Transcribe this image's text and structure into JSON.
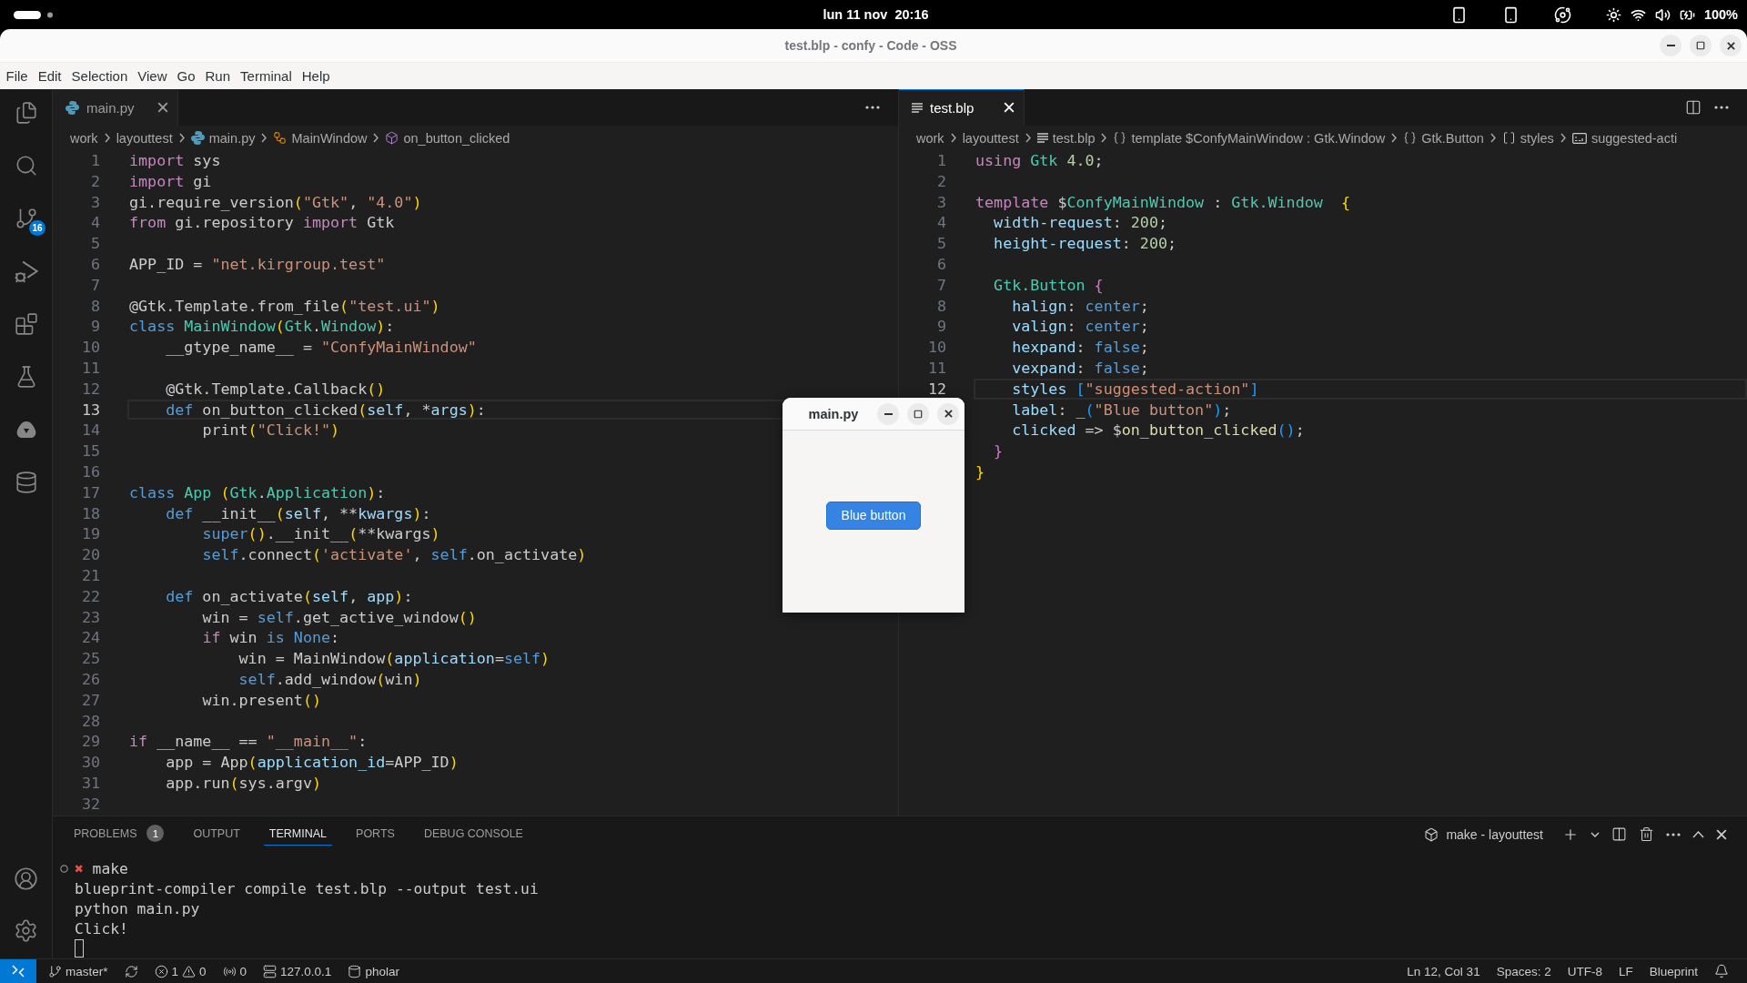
{
  "top_bar": {
    "clock": "lun 11 nov  20:16",
    "battery": "100%"
  },
  "window": {
    "title": "test.blp - confy - Code - OSS"
  },
  "menu": [
    "File",
    "Edit",
    "Selection",
    "View",
    "Go",
    "Run",
    "Terminal",
    "Help"
  ],
  "activity_bar": {
    "source_control_badge": "16"
  },
  "editor_groups": [
    {
      "focused": false,
      "tabs": [
        {
          "label": "main.py",
          "kind": "python",
          "selected": true
        }
      ],
      "breadcrumbs": [
        {
          "label": "work",
          "kind": "folder"
        },
        {
          "label": "layouttest",
          "kind": "folder"
        },
        {
          "label": "main.py",
          "kind": "python"
        },
        {
          "label": "MainWindow",
          "kind": "class"
        },
        {
          "label": "on_button_clicked",
          "kind": "method"
        }
      ],
      "lines": [
        {
          "number": "1",
          "current": false,
          "tokens": [
            {
              "kind": "keyword",
              "text": "import"
            },
            {
              "kind": "plain",
              "text": " sys"
            }
          ]
        },
        {
          "number": "2",
          "current": false,
          "tokens": [
            {
              "kind": "keyword",
              "text": "import"
            },
            {
              "kind": "plain",
              "text": " gi"
            }
          ]
        },
        {
          "number": "3",
          "current": false,
          "tokens": [
            {
              "kind": "plain",
              "text": "gi.require_version"
            },
            {
              "kind": "bracket1",
              "text": "("
            },
            {
              "kind": "string",
              "text": "\"Gtk\""
            },
            {
              "kind": "plain",
              "text": ", "
            },
            {
              "kind": "string",
              "text": "\"4.0\""
            },
            {
              "kind": "bracket1",
              "text": ")"
            }
          ]
        },
        {
          "number": "4",
          "current": false,
          "tokens": [
            {
              "kind": "keyword",
              "text": "from"
            },
            {
              "kind": "plain",
              "text": " gi.repository "
            },
            {
              "kind": "keyword",
              "text": "import"
            },
            {
              "kind": "plain",
              "text": " Gtk"
            }
          ]
        },
        {
          "number": "5",
          "current": false
        },
        {
          "number": "6",
          "current": false,
          "tokens": [
            {
              "kind": "plain",
              "text": "APP_ID = "
            },
            {
              "kind": "string",
              "text": "\"net.kirgroup.test\""
            }
          ]
        },
        {
          "number": "7",
          "current": false
        },
        {
          "number": "8",
          "current": false,
          "tokens": [
            {
              "kind": "plain",
              "text": "@Gtk.Template.from_file"
            },
            {
              "kind": "bracket1",
              "text": "("
            },
            {
              "kind": "string",
              "text": "\"test.ui\""
            },
            {
              "kind": "bracket1",
              "text": ")"
            }
          ]
        },
        {
          "number": "9",
          "current": false,
          "tokens": [
            {
              "kind": "storage",
              "text": "class "
            },
            {
              "kind": "type",
              "text": "MainWindow"
            },
            {
              "kind": "bracket1",
              "text": "("
            },
            {
              "kind": "type",
              "text": "Gtk"
            },
            {
              "kind": "plain",
              "text": "."
            },
            {
              "kind": "type",
              "text": "Window"
            },
            {
              "kind": "bracket1",
              "text": ")"
            },
            {
              "kind": "plain",
              "text": ":"
            }
          ]
        },
        {
          "number": "10",
          "current": false,
          "tokens": [
            {
              "kind": "plain",
              "text": "    __gtype_name__ = "
            },
            {
              "kind": "string",
              "text": "\"ConfyMainWindow\""
            }
          ]
        },
        {
          "number": "11",
          "current": false
        },
        {
          "number": "12",
          "current": false,
          "tokens": [
            {
              "kind": "plain",
              "text": "    @Gtk.Template.Callback"
            },
            {
              "kind": "bracket1",
              "text": "()"
            }
          ]
        },
        {
          "number": "13",
          "current": true,
          "tokens": [
            {
              "kind": "storage",
              "text": "    def"
            },
            {
              "kind": "plain",
              "text": " on_button_clicked"
            },
            {
              "kind": "bracket1",
              "text": "("
            },
            {
              "kind": "param",
              "text": "self"
            },
            {
              "kind": "plain",
              "text": ", *"
            },
            {
              "kind": "param",
              "text": "args"
            },
            {
              "kind": "bracket1",
              "text": ")"
            },
            {
              "kind": "plain",
              "text": ":"
            }
          ]
        },
        {
          "number": "14",
          "current": false,
          "tokens": [
            {
              "kind": "plain",
              "text": "        print"
            },
            {
              "kind": "bracket1",
              "text": "("
            },
            {
              "kind": "string",
              "text": "\"Click!\""
            },
            {
              "kind": "bracket1",
              "text": ")"
            }
          ]
        },
        {
          "number": "15",
          "current": false
        },
        {
          "number": "16",
          "current": false
        },
        {
          "number": "17",
          "current": false,
          "tokens": [
            {
              "kind": "storage",
              "text": "class "
            },
            {
              "kind": "type",
              "text": "App "
            },
            {
              "kind": "bracket1",
              "text": "("
            },
            {
              "kind": "type",
              "text": "Gtk"
            },
            {
              "kind": "plain",
              "text": "."
            },
            {
              "kind": "type",
              "text": "Application"
            },
            {
              "kind": "bracket1",
              "text": ")"
            },
            {
              "kind": "plain",
              "text": ":"
            }
          ]
        },
        {
          "number": "18",
          "current": false,
          "tokens": [
            {
              "kind": "storage",
              "text": "    def"
            },
            {
              "kind": "plain",
              "text": " __init__"
            },
            {
              "kind": "bracket1",
              "text": "("
            },
            {
              "kind": "param",
              "text": "self"
            },
            {
              "kind": "plain",
              "text": ", **"
            },
            {
              "kind": "param",
              "text": "kwargs"
            },
            {
              "kind": "bracket1",
              "text": ")"
            },
            {
              "kind": "plain",
              "text": ":"
            }
          ]
        },
        {
          "number": "19",
          "current": false,
          "tokens": [
            {
              "kind": "storage",
              "text": "        super"
            },
            {
              "kind": "bracket1",
              "text": "()"
            },
            {
              "kind": "plain",
              "text": ".__init__"
            },
            {
              "kind": "bracket1",
              "text": "("
            },
            {
              "kind": "plain",
              "text": "**kwargs"
            },
            {
              "kind": "bracket1",
              "text": ")"
            }
          ]
        },
        {
          "number": "20",
          "current": false,
          "tokens": [
            {
              "kind": "storage",
              "text": "        self"
            },
            {
              "kind": "plain",
              "text": ".connect"
            },
            {
              "kind": "bracket1",
              "text": "("
            },
            {
              "kind": "string",
              "text": "'activate'"
            },
            {
              "kind": "plain",
              "text": ", "
            },
            {
              "kind": "storage",
              "text": "self"
            },
            {
              "kind": "plain",
              "text": ".on_activate"
            },
            {
              "kind": "bracket1",
              "text": ")"
            }
          ]
        },
        {
          "number": "21",
          "current": false
        },
        {
          "number": "22",
          "current": false,
          "tokens": [
            {
              "kind": "storage",
              "text": "    def"
            },
            {
              "kind": "plain",
              "text": " on_activate"
            },
            {
              "kind": "bracket1",
              "text": "("
            },
            {
              "kind": "param",
              "text": "self"
            },
            {
              "kind": "plain",
              "text": ", "
            },
            {
              "kind": "param",
              "text": "app"
            },
            {
              "kind": "bracket1",
              "text": ")"
            },
            {
              "kind": "plain",
              "text": ":"
            }
          ]
        },
        {
          "number": "23",
          "current": false,
          "tokens": [
            {
              "kind": "plain",
              "text": "        win = "
            },
            {
              "kind": "storage",
              "text": "self"
            },
            {
              "kind": "plain",
              "text": ".get_active_window"
            },
            {
              "kind": "bracket1",
              "text": "()"
            }
          ]
        },
        {
          "number": "24",
          "current": false,
          "tokens": [
            {
              "kind": "keyword",
              "text": "        if"
            },
            {
              "kind": "plain",
              "text": " win "
            },
            {
              "kind": "storage",
              "text": "is None"
            },
            {
              "kind": "plain",
              "text": ":"
            }
          ]
        },
        {
          "number": "25",
          "current": false,
          "tokens": [
            {
              "kind": "plain",
              "text": "            win = MainWindow"
            },
            {
              "kind": "bracket1",
              "text": "("
            },
            {
              "kind": "param",
              "text": "application"
            },
            {
              "kind": "plain",
              "text": "="
            },
            {
              "kind": "storage",
              "text": "self"
            },
            {
              "kind": "bracket1",
              "text": ")"
            }
          ]
        },
        {
          "number": "26",
          "current": false,
          "tokens": [
            {
              "kind": "storage",
              "text": "            self"
            },
            {
              "kind": "plain",
              "text": ".add_window"
            },
            {
              "kind": "bracket1",
              "text": "("
            },
            {
              "kind": "plain",
              "text": "win"
            },
            {
              "kind": "bracket1",
              "text": ")"
            }
          ]
        },
        {
          "number": "27",
          "current": false,
          "tokens": [
            {
              "kind": "plain",
              "text": "        win.present"
            },
            {
              "kind": "bracket1",
              "text": "()"
            }
          ]
        },
        {
          "number": "28",
          "current": false
        },
        {
          "number": "29",
          "current": false,
          "tokens": [
            {
              "kind": "keyword",
              "text": "if"
            },
            {
              "kind": "plain",
              "text": " __name__ == "
            },
            {
              "kind": "string",
              "text": "\"__main__\""
            },
            {
              "kind": "plain",
              "text": ":"
            }
          ]
        },
        {
          "number": "30",
          "current": false,
          "tokens": [
            {
              "kind": "plain",
              "text": "    app = App"
            },
            {
              "kind": "bracket1",
              "text": "("
            },
            {
              "kind": "param",
              "text": "application_id"
            },
            {
              "kind": "plain",
              "text": "=APP_ID"
            },
            {
              "kind": "bracket1",
              "text": ")"
            }
          ]
        },
        {
          "number": "31",
          "current": false,
          "tokens": [
            {
              "kind": "plain",
              "text": "    app.run"
            },
            {
              "kind": "bracket1",
              "text": "("
            },
            {
              "kind": "plain",
              "text": "sys.argv"
            },
            {
              "kind": "bracket1",
              "text": ")"
            }
          ]
        },
        {
          "number": "32",
          "current": false
        }
      ]
    },
    {
      "focused": true,
      "tabs": [
        {
          "label": "test.blp",
          "kind": "text",
          "selected": true
        }
      ],
      "breadcrumbs": [
        {
          "label": "work",
          "kind": "folder"
        },
        {
          "label": "layouttest",
          "kind": "folder"
        },
        {
          "label": "test.blp",
          "kind": "text"
        },
        {
          "label": "template $ConfyMainWindow : Gtk.Window",
          "kind": "object"
        },
        {
          "label": "Gtk.Button",
          "kind": "object"
        },
        {
          "label": "styles",
          "kind": "array"
        },
        {
          "label": "suggested-acti",
          "kind": "string"
        }
      ],
      "lines": [
        {
          "number": "1",
          "current": false,
          "tokens": [
            {
              "kind": "keyword",
              "text": "using "
            },
            {
              "kind": "type",
              "text": "Gtk "
            },
            {
              "kind": "number",
              "text": "4.0"
            },
            {
              "kind": "plain",
              "text": ";"
            }
          ]
        },
        {
          "number": "2",
          "current": false
        },
        {
          "number": "3",
          "current": false,
          "tokens": [
            {
              "kind": "keyword",
              "text": "template"
            },
            {
              "kind": "plain",
              "text": " $"
            },
            {
              "kind": "type",
              "text": "ConfyMainWindow"
            },
            {
              "kind": "plain",
              "text": " : "
            },
            {
              "kind": "type",
              "text": "Gtk.Window  "
            },
            {
              "kind": "bracket1",
              "text": "{"
            }
          ]
        },
        {
          "number": "4",
          "current": false,
          "tokens": [
            {
              "kind": "prop",
              "text": "  width-request"
            },
            {
              "kind": "plain",
              "text": ": "
            },
            {
              "kind": "number",
              "text": "200"
            },
            {
              "kind": "plain",
              "text": ";"
            }
          ]
        },
        {
          "number": "5",
          "current": false,
          "tokens": [
            {
              "kind": "prop",
              "text": "  height-request"
            },
            {
              "kind": "plain",
              "text": ": "
            },
            {
              "kind": "number",
              "text": "200"
            },
            {
              "kind": "plain",
              "text": ";"
            }
          ]
        },
        {
          "number": "6",
          "current": false
        },
        {
          "number": "7",
          "current": false,
          "tokens": [
            {
              "kind": "type",
              "text": "  Gtk.Button "
            },
            {
              "kind": "bracket2",
              "text": "{"
            }
          ]
        },
        {
          "number": "8",
          "current": false,
          "tokens": [
            {
              "kind": "prop",
              "text": "    halign"
            },
            {
              "kind": "plain",
              "text": ": "
            },
            {
              "kind": "value",
              "text": "center"
            },
            {
              "kind": "plain",
              "text": ";"
            }
          ]
        },
        {
          "number": "9",
          "current": false,
          "tokens": [
            {
              "kind": "prop",
              "text": "    valign"
            },
            {
              "kind": "plain",
              "text": ": "
            },
            {
              "kind": "value",
              "text": "center"
            },
            {
              "kind": "plain",
              "text": ";"
            }
          ]
        },
        {
          "number": "10",
          "current": false,
          "tokens": [
            {
              "kind": "prop",
              "text": "    hexpand"
            },
            {
              "kind": "plain",
              "text": ": "
            },
            {
              "kind": "value",
              "text": "false"
            },
            {
              "kind": "plain",
              "text": ";"
            }
          ]
        },
        {
          "number": "11",
          "current": false,
          "tokens": [
            {
              "kind": "prop",
              "text": "    vexpand"
            },
            {
              "kind": "plain",
              "text": ": "
            },
            {
              "kind": "value",
              "text": "false"
            },
            {
              "kind": "plain",
              "text": ";"
            }
          ]
        },
        {
          "number": "12",
          "current": true,
          "tokens": [
            {
              "kind": "prop",
              "text": "    styles "
            },
            {
              "kind": "bracket3",
              "text": "["
            },
            {
              "kind": "string",
              "text": "\"suggested-action\""
            },
            {
              "kind": "bracket3",
              "text": "]"
            }
          ]
        },
        {
          "current": false,
          "tokens": [
            {
              "kind": "prop",
              "text": "    label"
            },
            {
              "kind": "plain",
              "text": ": _"
            },
            {
              "kind": "bracket3",
              "text": "("
            },
            {
              "kind": "string",
              "text": "\"Blue button\""
            },
            {
              "kind": "bracket3",
              "text": ")"
            },
            {
              "kind": "plain",
              "text": ";"
            }
          ]
        },
        {
          "current": false,
          "tokens": [
            {
              "kind": "prop",
              "text": "    clicked"
            },
            {
              "kind": "plain",
              "text": " => $"
            },
            {
              "kind": "func",
              "text": "on_button_clicked"
            },
            {
              "kind": "bracket3",
              "text": "()"
            },
            {
              "kind": "plain",
              "text": ";"
            }
          ]
        },
        {
          "current": false,
          "tokens": [
            {
              "kind": "bracket2",
              "text": "  }"
            }
          ]
        },
        {
          "current": false,
          "tokens": [
            {
              "kind": "bracket1",
              "text": "}"
            }
          ]
        }
      ]
    }
  ],
  "floating_window": {
    "title": "main.py",
    "button": "Blue button"
  },
  "panel": {
    "tabs": [
      {
        "label": "PROBLEMS",
        "badge": "1",
        "selected": false
      },
      {
        "label": "OUTPUT",
        "selected": false
      },
      {
        "label": "TERMINAL",
        "selected": true
      },
      {
        "label": "PORTS",
        "selected": false
      },
      {
        "label": "DEBUG CONSOLE",
        "selected": false
      }
    ],
    "terminal_name": "make - layouttest",
    "terminal": [
      {
        "kind": "command",
        "prompt": "✖",
        "text": "make"
      },
      {
        "kind": "output",
        "text": "blueprint-compiler compile test.blp --output test.ui"
      },
      {
        "kind": "output",
        "text": "python main.py"
      },
      {
        "kind": "output",
        "text": "Click!"
      }
    ]
  },
  "status_bar": {
    "branch": "master*",
    "errors": "1",
    "warnings": "0",
    "ports": "0",
    "host": "127.0.0.1",
    "database": "pholar",
    "position": "Ln 12, Col 31",
    "indent": "Spaces: 2",
    "encoding": "UTF-8",
    "eol": "LF",
    "language": "Blueprint"
  }
}
